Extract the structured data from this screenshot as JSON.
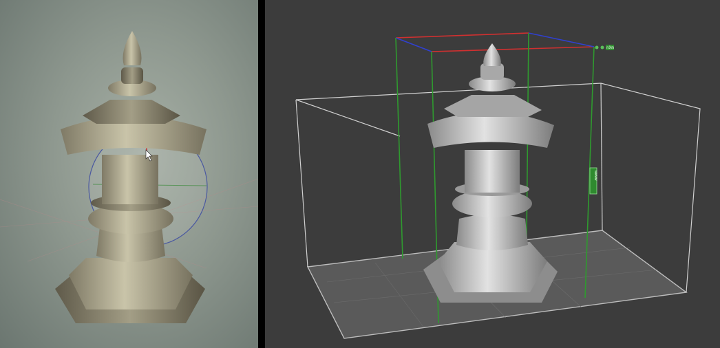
{
  "colors": {
    "left_background": "#8e988f",
    "right_background": "#3c3c3c",
    "stone_textured": "#b3ad93",
    "stone_mesh": "#c9c9c9",
    "bbox_lines": "#d0d0d0",
    "gizmo_x": "#d03030",
    "gizmo_y": "#2f9a2f",
    "gizmo_z": "#3040d0"
  },
  "left_panel": {
    "view": "textured-photogrammetry-model",
    "cursor": "arrow-cursor"
  },
  "right_panel": {
    "view": "mesh-with-bounding-box",
    "gizmo_tag": "nXm",
    "side_tag": "wwww"
  }
}
